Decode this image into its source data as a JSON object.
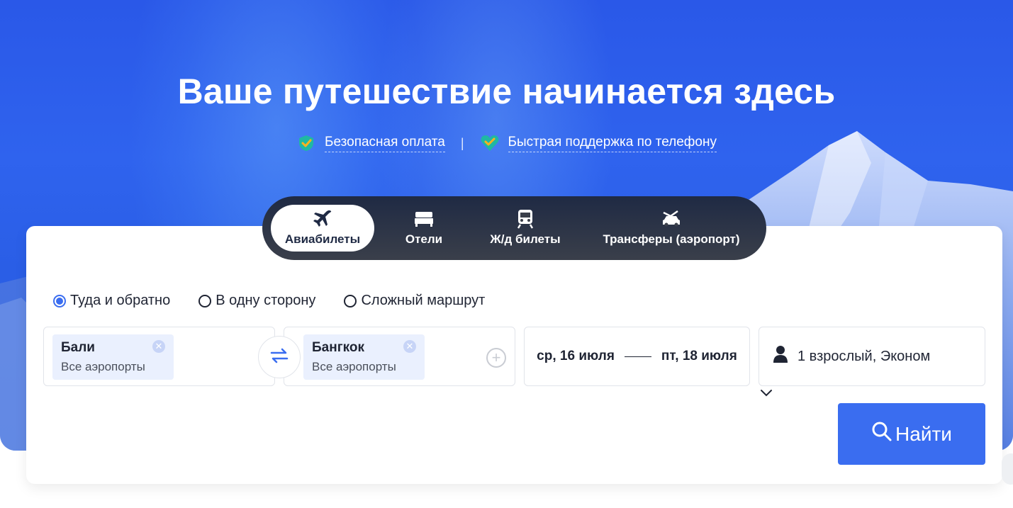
{
  "hero": {
    "title": "Ваше путешествие начинается здесь",
    "features": [
      {
        "label": "Безопасная оплата",
        "icon": "shield-check-icon"
      },
      {
        "label": "Быстрая поддержка по телефону",
        "icon": "heart-check-icon"
      }
    ],
    "separator": "|"
  },
  "tabs": [
    {
      "label": "Авиабилеты",
      "icon": "plane-icon",
      "active": true
    },
    {
      "label": "Отели",
      "icon": "bed-icon",
      "active": false
    },
    {
      "label": "Ж/д билеты",
      "icon": "train-icon",
      "active": false
    },
    {
      "label": "Трансферы (аэропорт)",
      "icon": "car-icon",
      "active": false
    }
  ],
  "trip_types": [
    {
      "label": "Туда и обратно",
      "checked": true
    },
    {
      "label": "В одну сторону",
      "checked": false
    },
    {
      "label": "Сложный маршрут",
      "checked": false
    }
  ],
  "from": {
    "city": "Бали",
    "airports": "Все аэропорты"
  },
  "to": {
    "city": "Бангкок",
    "airports": "Все аэропорты"
  },
  "dates": {
    "depart": "ср, 16 июля",
    "return": "пт, 18 июля"
  },
  "passengers": {
    "label": "1 взрослый, Эконом"
  },
  "search": {
    "label": "Найти"
  },
  "colors": {
    "accent": "#3a6df0",
    "tab_bar": "#2b3247",
    "hero_blue": "#2f63ee"
  }
}
